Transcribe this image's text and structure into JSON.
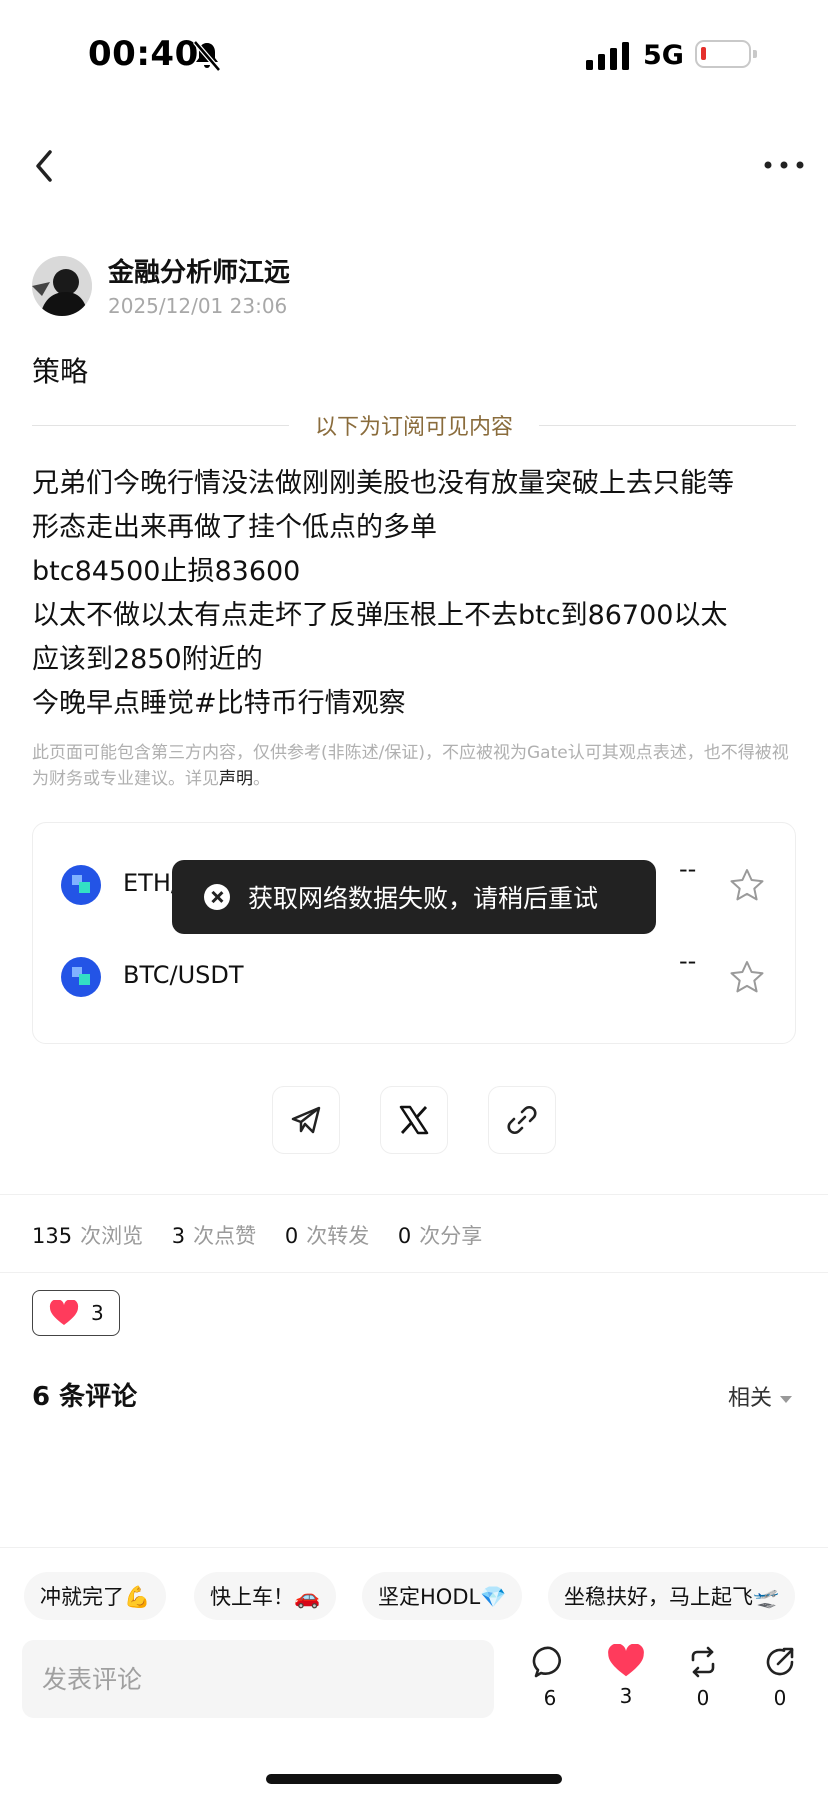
{
  "status_bar": {
    "time": "00:40",
    "network": "5G"
  },
  "author": {
    "name": "金融分析师江远",
    "timestamp": "2025/12/01 23:06"
  },
  "post": {
    "title": "策略",
    "subscription_divider": "以下为订阅可见内容",
    "body_lines": [
      "兄弟们今晚行情没法做刚刚美股也没有放量突破上去只能等",
      "形态走出来再做了挂个低点的多单",
      "btc84500止损83600",
      "以太不做以太有点走坏了反弹压根上不去btc到86700以太",
      "应该到2850附近的",
      "今晚早点睡觉#比特币行情观察"
    ],
    "disclaimer_text": "此页面可能包含第三方内容，仅供参考(非陈述/保证)，不应被视为Gate认可其观点表述，也不得被视为财务或专业建议。详见",
    "disclaimer_link": "声明",
    "disclaimer_end": "。"
  },
  "market_card": {
    "pairs": [
      {
        "name": "ETH/",
        "price": "--"
      },
      {
        "name": "BTC/USDT",
        "price": "--"
      }
    ]
  },
  "toast": {
    "message": "获取网络数据失败，请稍后重试"
  },
  "share": {
    "icons": [
      "telegram-icon",
      "x-icon",
      "link-icon"
    ]
  },
  "stats": [
    {
      "value": "135",
      "label": "次浏览"
    },
    {
      "value": "3",
      "label": "次点赞"
    },
    {
      "value": "0",
      "label": "次转发"
    },
    {
      "value": "0",
      "label": "次分享"
    }
  ],
  "reaction": {
    "count": "3"
  },
  "comments": {
    "title": "6 条评论",
    "sort_label": "相关"
  },
  "quick_replies": [
    "冲就完了💪",
    "快上车！🚗",
    "坚定HODL💎",
    "坐稳扶好，马上起飞🛫"
  ],
  "comment_input": {
    "placeholder": "发表评论"
  },
  "actions": [
    {
      "icon": "comment-icon",
      "count": "6"
    },
    {
      "icon": "heart-icon",
      "count": "3"
    },
    {
      "icon": "repost-icon",
      "count": "0"
    },
    {
      "icon": "share-icon",
      "count": "0"
    }
  ],
  "colors": {
    "accent_gold": "#8a6c3c",
    "like_red": "#ff3b5c",
    "coin_blue": "#2354e6",
    "toast_bg": "#222222"
  }
}
